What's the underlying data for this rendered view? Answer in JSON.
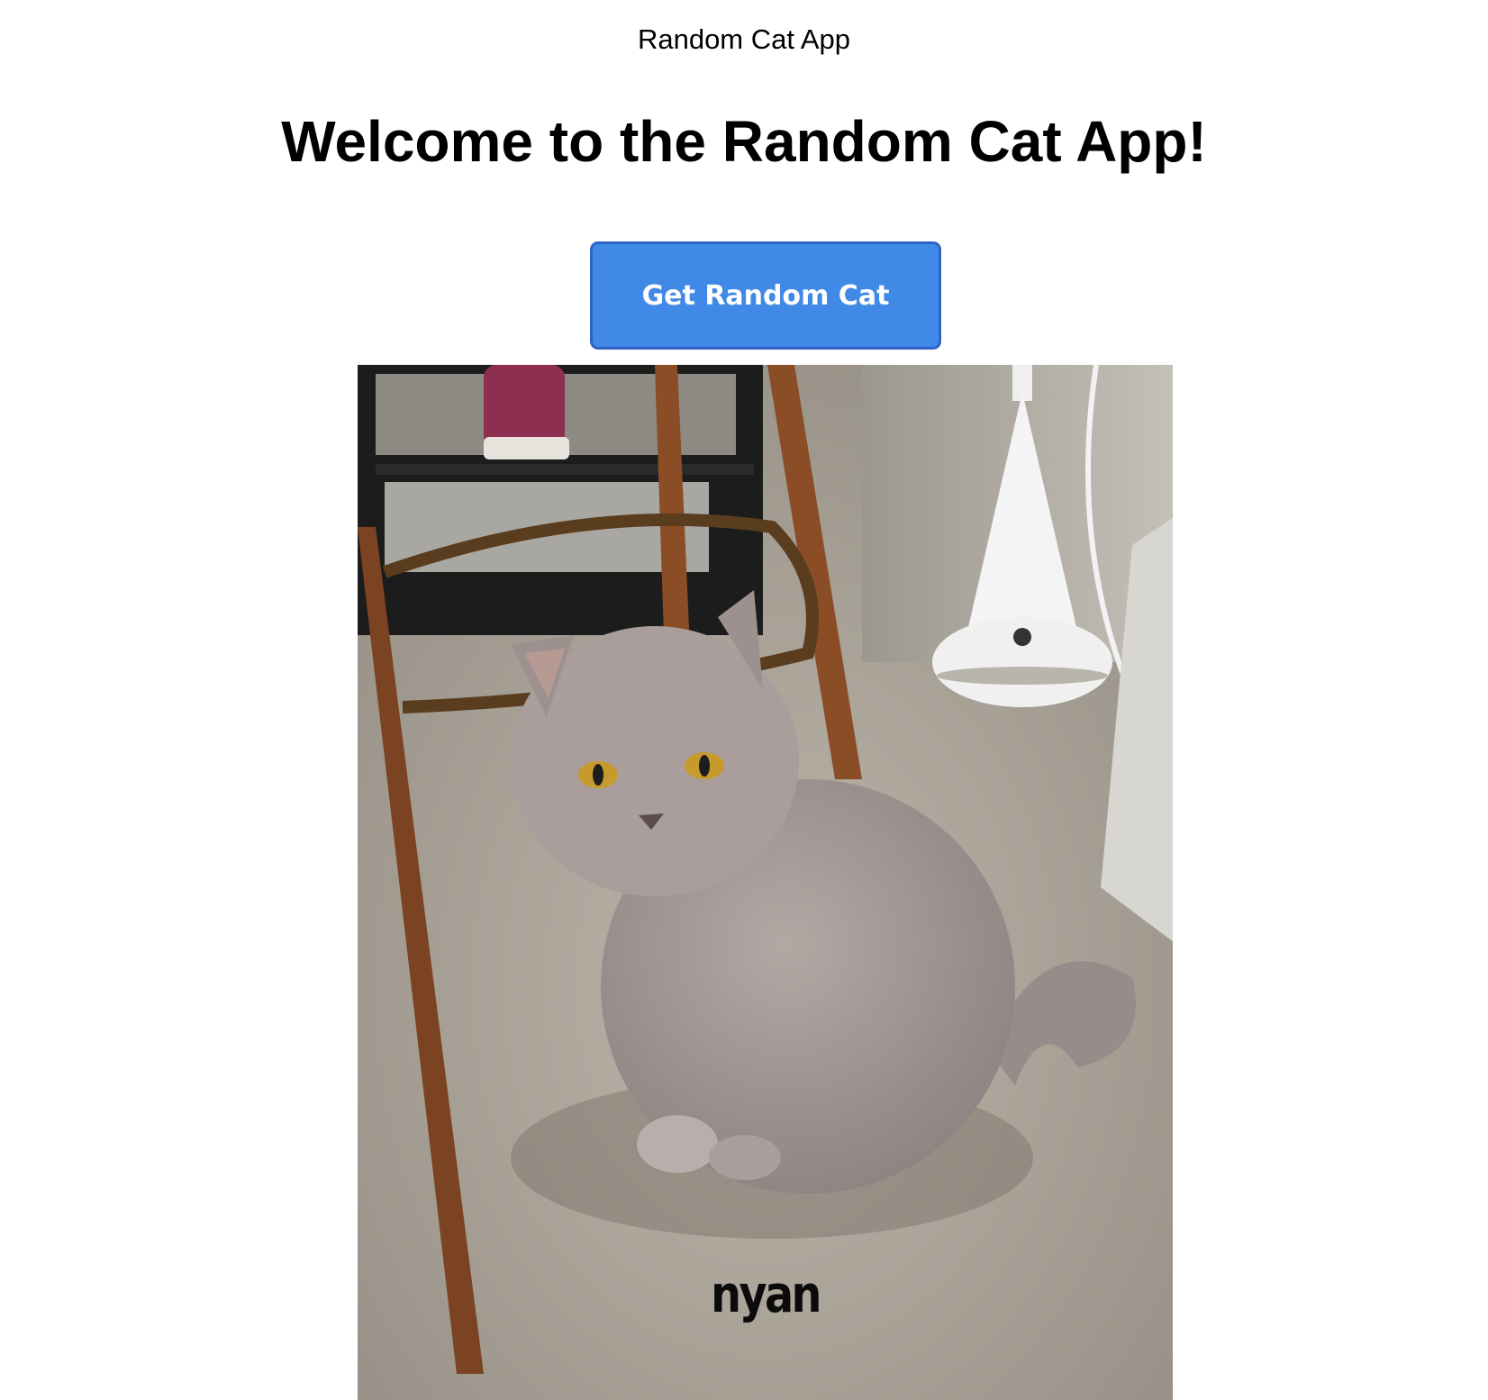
{
  "page": {
    "app_title": "Random Cat App",
    "heading": "Welcome to the Random Cat App!"
  },
  "controls": {
    "get_cat_label": "Get Random Cat"
  },
  "cat_image": {
    "caption": "nyan"
  },
  "colors": {
    "button_background": "#4089e6",
    "button_border": "#2f63c8",
    "button_text": "#ffffff",
    "page_background": "#ffffff"
  }
}
